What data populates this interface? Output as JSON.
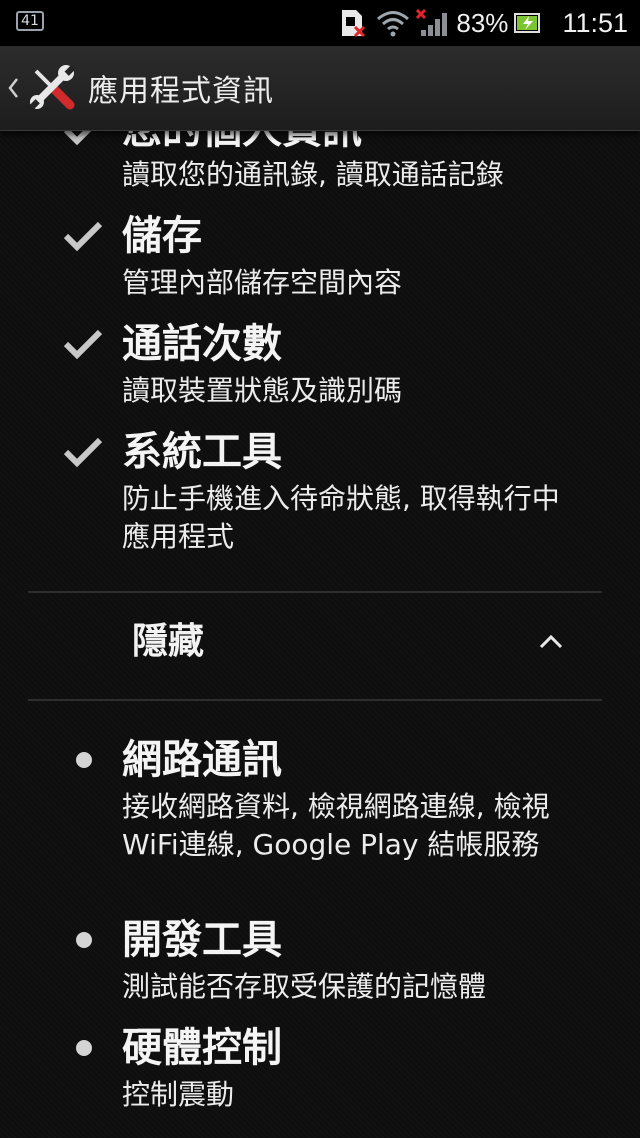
{
  "status_bar": {
    "notification_count": "41",
    "battery_percent": "83%",
    "time": "11:51",
    "icons": [
      "notification-badge-icon",
      "sim-error-icon",
      "wifi-icon",
      "signal-no-service-icon",
      "battery-charging-icon"
    ]
  },
  "action_bar": {
    "title": "應用程式資訊",
    "back_icon": "chevron-left-icon",
    "app_icon": "tools-wrench-screwdriver-icon"
  },
  "permissions": {
    "granted": [
      {
        "title": "您的個人資訊",
        "description": "讀取您的通訊錄, 讀取通話記錄",
        "icon": "check-icon"
      },
      {
        "title": "儲存",
        "description": "管理內部儲存空間內容",
        "icon": "check-icon"
      },
      {
        "title": "通話次數",
        "description": "讀取裝置狀態及識別碼",
        "icon": "check-icon"
      },
      {
        "title": "系統工具",
        "description": "防止手機進入待命狀態, 取得執行中應用程式",
        "icon": "check-icon"
      }
    ],
    "hidden_section": {
      "title": "隱藏",
      "toggle_icon": "chevron-up-icon"
    },
    "hidden": [
      {
        "title": "網路通訊",
        "description": "接收網路資料, 檢視網路連線, 檢視WiFi連線, Google Play 結帳服務",
        "icon": "bullet-icon"
      },
      {
        "title": "開發工具",
        "description": "測試能否存取受保護的記憶體",
        "icon": "bullet-icon"
      },
      {
        "title": "硬體控制",
        "description": "控制震動",
        "icon": "bullet-icon"
      }
    ]
  },
  "colors": {
    "background": "#0b0b0b",
    "text_primary": "#f4f4f4",
    "checkmark": "#c8c8c8",
    "divider": "#2e2e2e",
    "action_bar": "#262626"
  }
}
